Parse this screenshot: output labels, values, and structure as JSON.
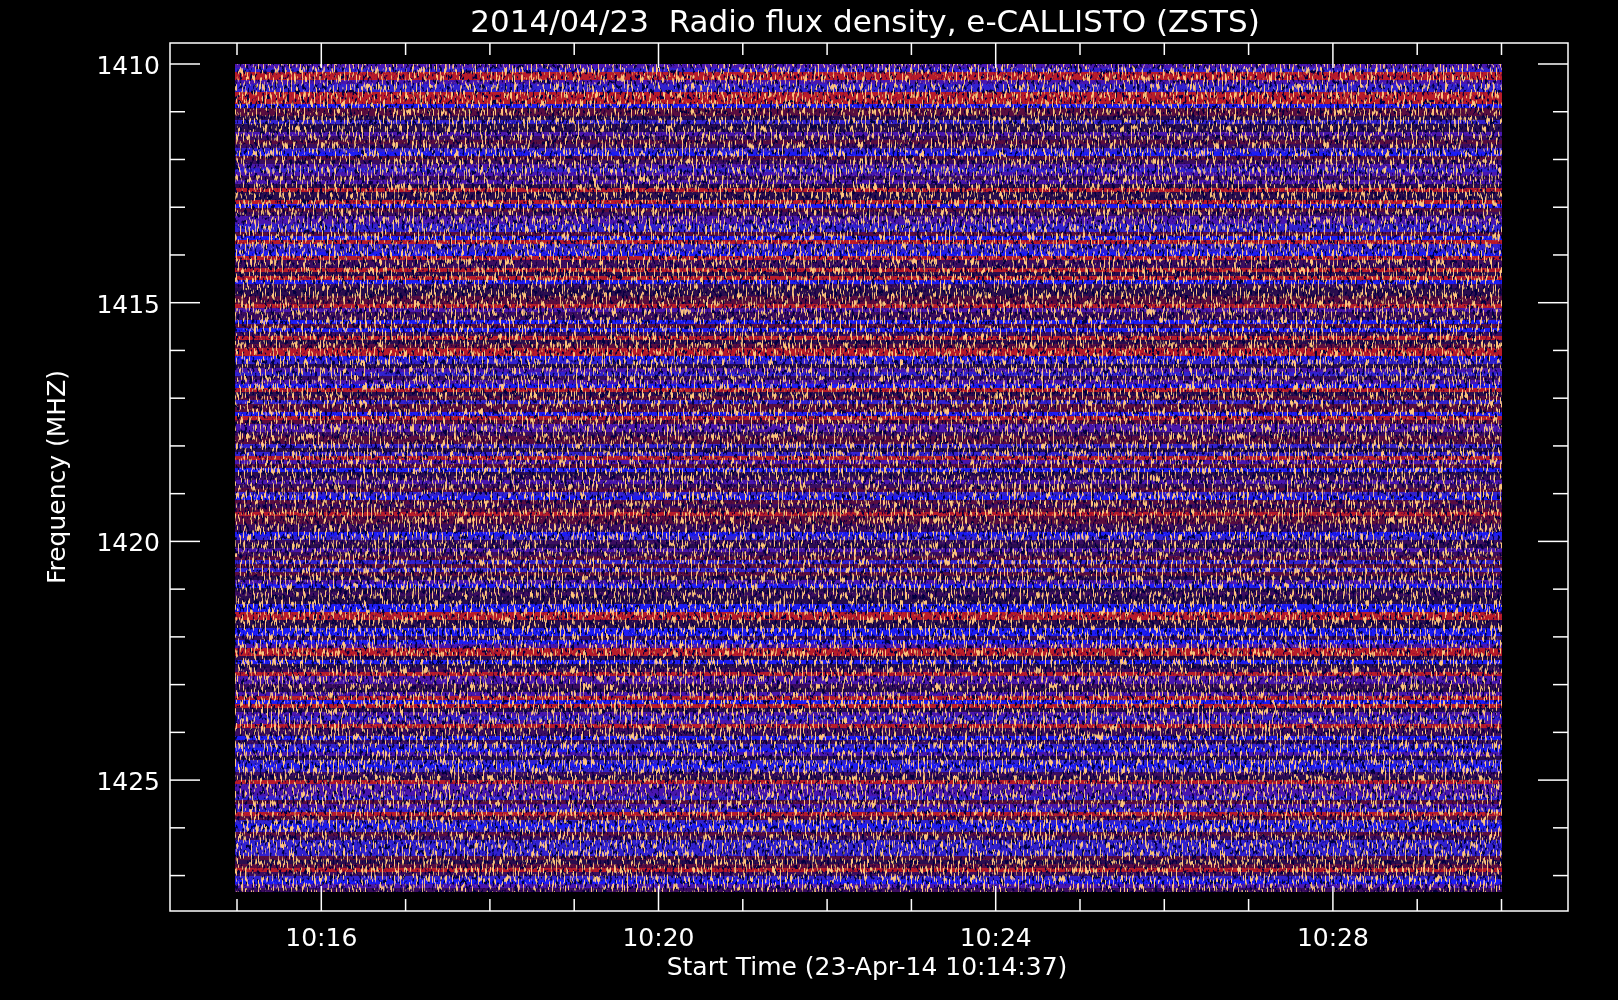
{
  "title": "2014/04/23  Radio flux density, e-CALLISTO (ZSTS)",
  "y_axis": {
    "label": "Frequency (MHZ)",
    "ticks": [
      "1410",
      "1415",
      "1420",
      "1425"
    ]
  },
  "x_axis": {
    "label": "Start Time (23-Apr-14 10:14:37)",
    "ticks": [
      "10:16",
      "10:20",
      "10:24",
      "10:28"
    ]
  }
}
